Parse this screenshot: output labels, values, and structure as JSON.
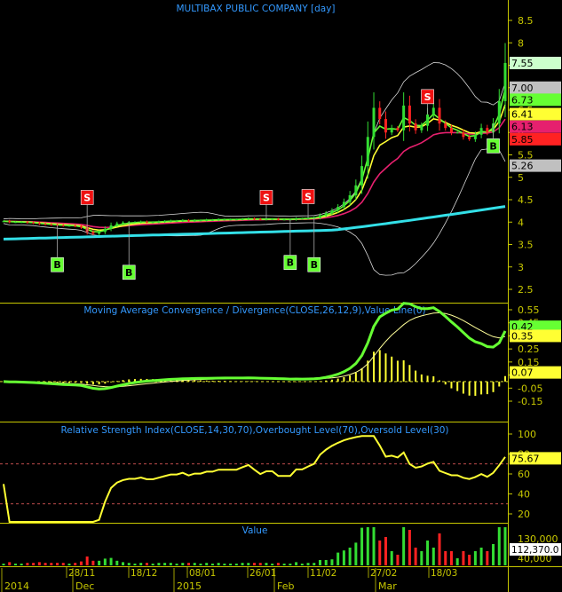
{
  "colors": {
    "background": "#000000",
    "axis": "#c8c800",
    "title": "#3399ff",
    "grid": "#2a2a2a",
    "up": "#33dd33",
    "down": "#ff2222",
    "ma_long": "#33e0e8",
    "ma_mid": "#e6206e",
    "ma_short": "#ffff33",
    "ma_fast": "#66ff33",
    "bollinger": "#d8d8d8",
    "buy_marker": "#66ff33",
    "sell_marker": "#ee1111",
    "rsi_line": "#ffff33",
    "rsi_levels": "#ff6666",
    "histogram": "#ffff33"
  },
  "chart_data": [
    {
      "type": "candlestick",
      "title": "MULTIBAX PUBLIC COMPANY [day]",
      "y_ticks": [
        "8.5",
        "8",
        "7.5",
        "7",
        "6.5",
        "6",
        "5.5",
        "5",
        "4.5",
        "4",
        "3.5",
        "3",
        "2.5"
      ],
      "ylim": [
        2.25,
        8.85
      ],
      "date_labels": [
        "2014",
        "Dec",
        "2015",
        "Feb",
        "Mar"
      ],
      "date_sub_labels": [
        "28/11",
        "18/12",
        "08/01",
        "26/01",
        "11/02",
        "27/02",
        "18/03"
      ],
      "close": [
        4.02,
        4.0,
        4.0,
        4.0,
        3.99,
        3.98,
        3.96,
        3.95,
        3.94,
        3.93,
        3.92,
        3.92,
        3.91,
        3.88,
        3.78,
        3.74,
        3.78,
        3.85,
        3.93,
        3.97,
        3.99,
        4.0,
        4.0,
        4.01,
        4.0,
        4.0,
        4.01,
        4.02,
        4.03,
        4.03,
        4.04,
        4.03,
        4.04,
        4.04,
        4.05,
        4.05,
        4.06,
        4.06,
        4.06,
        4.06,
        4.07,
        4.08,
        4.07,
        4.06,
        4.07,
        4.07,
        4.06,
        4.06,
        4.06,
        4.08,
        4.08,
        4.09,
        4.1,
        4.15,
        4.2,
        4.26,
        4.34,
        4.45,
        4.6,
        4.82,
        5.25,
        5.9,
        6.55,
        6.3,
        6.0,
        6.1,
        6.05,
        6.6,
        6.2,
        6.05,
        6.15,
        6.4,
        6.55,
        6.2,
        6.1,
        6.0,
        6.0,
        5.9,
        5.85,
        5.95,
        6.1,
        6.0,
        6.2,
        6.7,
        7.55
      ],
      "value_labels": [
        {
          "value": "7.55",
          "color": "#ccffcc"
        },
        {
          "value": "7.00",
          "color": "#c0c0c0"
        },
        {
          "value": "6.73",
          "color": "#66ff33"
        },
        {
          "value": "6.41",
          "color": "#ffff33"
        },
        {
          "value": "6.13",
          "color": "#e6206e"
        },
        {
          "value": "5.85",
          "color": "#ff2222"
        },
        {
          "value": "5.26",
          "color": "#c0c0c0"
        }
      ],
      "signals": [
        {
          "type": "S",
          "index": 14,
          "price": 4.55
        },
        {
          "type": "S",
          "index": 44,
          "price": 4.55
        },
        {
          "type": "S",
          "index": 51,
          "price": 4.57
        },
        {
          "type": "S",
          "index": 71,
          "price": 6.8
        },
        {
          "type": "B",
          "index": 9,
          "price": 3.05
        },
        {
          "type": "B",
          "index": 21,
          "price": 2.88
        },
        {
          "type": "B",
          "index": 48,
          "price": 3.1
        },
        {
          "type": "B",
          "index": 52,
          "price": 3.05
        },
        {
          "type": "B",
          "index": 82,
          "price": 5.7
        }
      ]
    },
    {
      "type": "line",
      "title": "Moving Average Convergence / Divergence(CLOSE,26,12,9),Value Line(0)",
      "y_ticks": [
        "0.55",
        "0.45",
        "0.35",
        "0.25",
        "0.15",
        "0.05",
        "-0.05",
        "-0.15"
      ],
      "ylim": [
        -0.185,
        0.575
      ],
      "value_labels": [
        {
          "value": "0.42",
          "color": "#66ff33"
        },
        {
          "value": "0.35",
          "color": "#ffff33"
        },
        {
          "value": "0.07",
          "color": "#ffff33"
        }
      ]
    },
    {
      "type": "line",
      "title": "Relative Strength Index(CLOSE,14,30,70),Overbought Level(70),Oversold Level(30)",
      "y_ticks": [
        "100",
        "80",
        "60",
        "40",
        "20"
      ],
      "ylim": [
        10,
        107
      ],
      "levels": [
        70,
        30
      ],
      "value_labels": [
        {
          "value": "75.67",
          "color": "#ffff33"
        }
      ]
    },
    {
      "type": "bar",
      "title": "Value",
      "y_ticks": [
        "130,000",
        "40,000"
      ],
      "value_labels": [
        {
          "value": "112,370.0",
          "color": "#ffffff"
        }
      ]
    }
  ]
}
